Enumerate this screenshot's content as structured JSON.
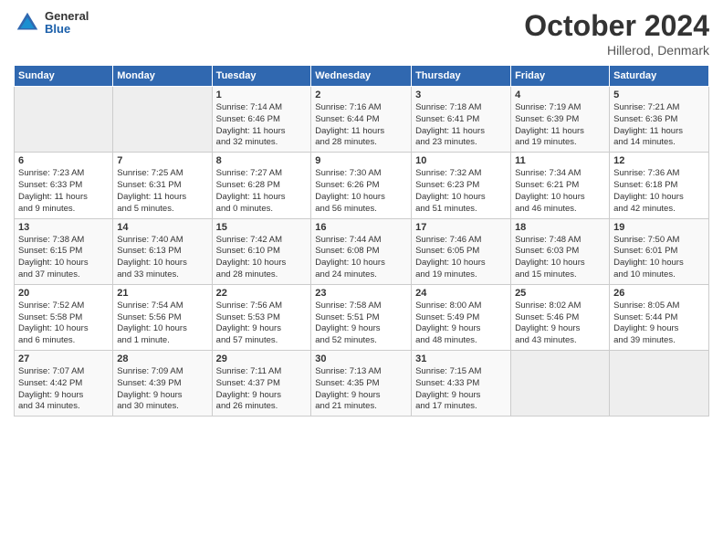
{
  "header": {
    "logo_general": "General",
    "logo_blue": "Blue",
    "month_title": "October 2024",
    "subtitle": "Hillerod, Denmark"
  },
  "days_of_week": [
    "Sunday",
    "Monday",
    "Tuesday",
    "Wednesday",
    "Thursday",
    "Friday",
    "Saturday"
  ],
  "weeks": [
    [
      {
        "day": "",
        "info": ""
      },
      {
        "day": "",
        "info": ""
      },
      {
        "day": "1",
        "info": "Sunrise: 7:14 AM\nSunset: 6:46 PM\nDaylight: 11 hours\nand 32 minutes."
      },
      {
        "day": "2",
        "info": "Sunrise: 7:16 AM\nSunset: 6:44 PM\nDaylight: 11 hours\nand 28 minutes."
      },
      {
        "day": "3",
        "info": "Sunrise: 7:18 AM\nSunset: 6:41 PM\nDaylight: 11 hours\nand 23 minutes."
      },
      {
        "day": "4",
        "info": "Sunrise: 7:19 AM\nSunset: 6:39 PM\nDaylight: 11 hours\nand 19 minutes."
      },
      {
        "day": "5",
        "info": "Sunrise: 7:21 AM\nSunset: 6:36 PM\nDaylight: 11 hours\nand 14 minutes."
      }
    ],
    [
      {
        "day": "6",
        "info": "Sunrise: 7:23 AM\nSunset: 6:33 PM\nDaylight: 11 hours\nand 9 minutes."
      },
      {
        "day": "7",
        "info": "Sunrise: 7:25 AM\nSunset: 6:31 PM\nDaylight: 11 hours\nand 5 minutes."
      },
      {
        "day": "8",
        "info": "Sunrise: 7:27 AM\nSunset: 6:28 PM\nDaylight: 11 hours\nand 0 minutes."
      },
      {
        "day": "9",
        "info": "Sunrise: 7:30 AM\nSunset: 6:26 PM\nDaylight: 10 hours\nand 56 minutes."
      },
      {
        "day": "10",
        "info": "Sunrise: 7:32 AM\nSunset: 6:23 PM\nDaylight: 10 hours\nand 51 minutes."
      },
      {
        "day": "11",
        "info": "Sunrise: 7:34 AM\nSunset: 6:21 PM\nDaylight: 10 hours\nand 46 minutes."
      },
      {
        "day": "12",
        "info": "Sunrise: 7:36 AM\nSunset: 6:18 PM\nDaylight: 10 hours\nand 42 minutes."
      }
    ],
    [
      {
        "day": "13",
        "info": "Sunrise: 7:38 AM\nSunset: 6:15 PM\nDaylight: 10 hours\nand 37 minutes."
      },
      {
        "day": "14",
        "info": "Sunrise: 7:40 AM\nSunset: 6:13 PM\nDaylight: 10 hours\nand 33 minutes."
      },
      {
        "day": "15",
        "info": "Sunrise: 7:42 AM\nSunset: 6:10 PM\nDaylight: 10 hours\nand 28 minutes."
      },
      {
        "day": "16",
        "info": "Sunrise: 7:44 AM\nSunset: 6:08 PM\nDaylight: 10 hours\nand 24 minutes."
      },
      {
        "day": "17",
        "info": "Sunrise: 7:46 AM\nSunset: 6:05 PM\nDaylight: 10 hours\nand 19 minutes."
      },
      {
        "day": "18",
        "info": "Sunrise: 7:48 AM\nSunset: 6:03 PM\nDaylight: 10 hours\nand 15 minutes."
      },
      {
        "day": "19",
        "info": "Sunrise: 7:50 AM\nSunset: 6:01 PM\nDaylight: 10 hours\nand 10 minutes."
      }
    ],
    [
      {
        "day": "20",
        "info": "Sunrise: 7:52 AM\nSunset: 5:58 PM\nDaylight: 10 hours\nand 6 minutes."
      },
      {
        "day": "21",
        "info": "Sunrise: 7:54 AM\nSunset: 5:56 PM\nDaylight: 10 hours\nand 1 minute."
      },
      {
        "day": "22",
        "info": "Sunrise: 7:56 AM\nSunset: 5:53 PM\nDaylight: 9 hours\nand 57 minutes."
      },
      {
        "day": "23",
        "info": "Sunrise: 7:58 AM\nSunset: 5:51 PM\nDaylight: 9 hours\nand 52 minutes."
      },
      {
        "day": "24",
        "info": "Sunrise: 8:00 AM\nSunset: 5:49 PM\nDaylight: 9 hours\nand 48 minutes."
      },
      {
        "day": "25",
        "info": "Sunrise: 8:02 AM\nSunset: 5:46 PM\nDaylight: 9 hours\nand 43 minutes."
      },
      {
        "day": "26",
        "info": "Sunrise: 8:05 AM\nSunset: 5:44 PM\nDaylight: 9 hours\nand 39 minutes."
      }
    ],
    [
      {
        "day": "27",
        "info": "Sunrise: 7:07 AM\nSunset: 4:42 PM\nDaylight: 9 hours\nand 34 minutes."
      },
      {
        "day": "28",
        "info": "Sunrise: 7:09 AM\nSunset: 4:39 PM\nDaylight: 9 hours\nand 30 minutes."
      },
      {
        "day": "29",
        "info": "Sunrise: 7:11 AM\nSunset: 4:37 PM\nDaylight: 9 hours\nand 26 minutes."
      },
      {
        "day": "30",
        "info": "Sunrise: 7:13 AM\nSunset: 4:35 PM\nDaylight: 9 hours\nand 21 minutes."
      },
      {
        "day": "31",
        "info": "Sunrise: 7:15 AM\nSunset: 4:33 PM\nDaylight: 9 hours\nand 17 minutes."
      },
      {
        "day": "",
        "info": ""
      },
      {
        "day": "",
        "info": ""
      }
    ]
  ]
}
